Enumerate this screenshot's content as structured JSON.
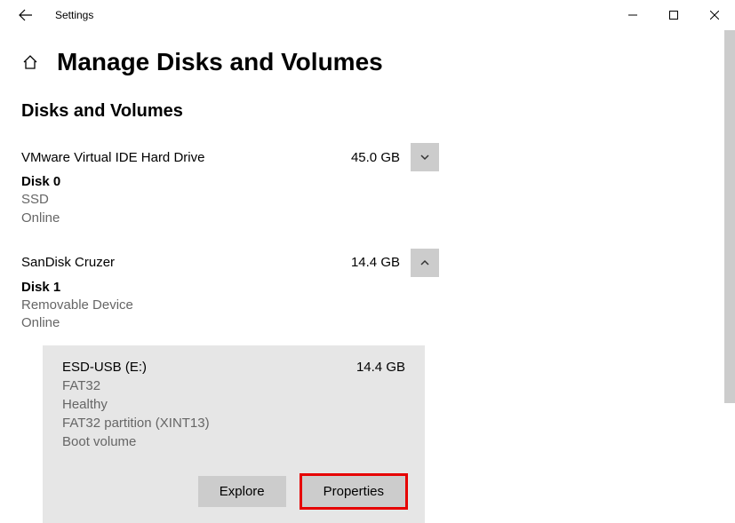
{
  "window": {
    "title": "Settings"
  },
  "header": {
    "heading": "Manage Disks and Volumes"
  },
  "section": {
    "title": "Disks and Volumes"
  },
  "disks": [
    {
      "name": "VMware Virtual IDE Hard Drive",
      "size": "45.0 GB",
      "id": "Disk 0",
      "type": "SSD",
      "status": "Online",
      "expanded": false
    },
    {
      "name": "SanDisk Cruzer",
      "size": "14.4 GB",
      "id": "Disk 1",
      "type": "Removable Device",
      "status": "Online",
      "expanded": true,
      "volume": {
        "name": "ESD-USB (E:)",
        "size": "14.4 GB",
        "fs": "FAT32",
        "health": "Healthy",
        "partition": "FAT32 partition (XINT13)",
        "role": "Boot volume"
      }
    }
  ],
  "buttons": {
    "explore": "Explore",
    "properties": "Properties"
  }
}
